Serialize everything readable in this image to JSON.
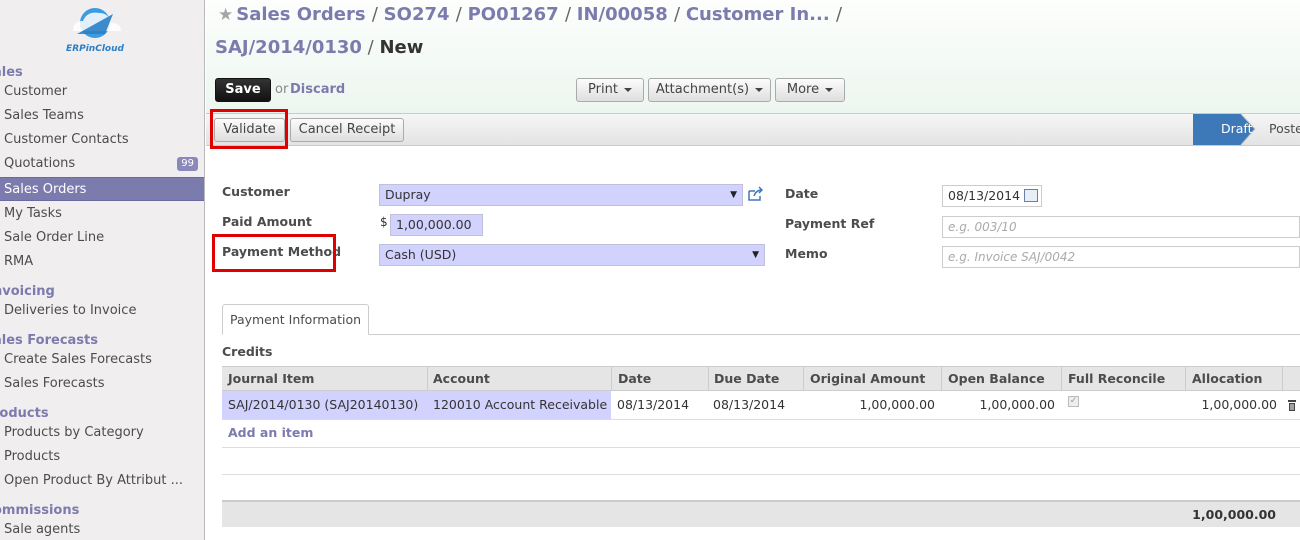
{
  "sidebar": {
    "sections": [
      {
        "label": "ales",
        "items": [
          {
            "label": "Customer"
          },
          {
            "label": "Sales Teams"
          },
          {
            "label": "Customer Contacts"
          },
          {
            "label": "Quotations",
            "badge": "99"
          },
          {
            "label": "Sales Orders",
            "active": true
          },
          {
            "label": "My Tasks"
          },
          {
            "label": "Sale Order Line"
          },
          {
            "label": "RMA"
          }
        ]
      },
      {
        "label": "nvoicing",
        "items": [
          {
            "label": "Deliveries to Invoice"
          }
        ]
      },
      {
        "label": "ales Forecasts",
        "items": [
          {
            "label": "Create Sales Forecasts"
          },
          {
            "label": "Sales Forecasts"
          }
        ]
      },
      {
        "label": "roducts",
        "items": [
          {
            "label": "Products by Category"
          },
          {
            "label": "Products"
          },
          {
            "label": "Open Product By Attribut ..."
          }
        ]
      },
      {
        "label": "ommissions",
        "items": [
          {
            "label": "Sale agents"
          }
        ]
      }
    ],
    "logo_text": "ERPinCloud"
  },
  "breadcrumb": {
    "items": [
      "Sales Orders",
      "SO274",
      "PO01267",
      "IN/00058",
      "Customer In..."
    ],
    "line2_link": "SAJ/2014/0130",
    "current": "New"
  },
  "toolbar": {
    "save": "Save",
    "or": "or",
    "discard": "Discard",
    "print": "Print",
    "attachments": "Attachment(s)",
    "more": "More"
  },
  "statusbar": {
    "validate": "Validate",
    "cancel_receipt": "Cancel Receipt",
    "states": [
      "Draft",
      "Poste"
    ]
  },
  "form": {
    "customer_label": "Customer",
    "customer_value": "Dupray",
    "paid_amount_label": "Paid Amount",
    "currency_symbol": "$",
    "paid_amount_value": "1,00,000.00",
    "payment_method_label": "Payment Method",
    "payment_method_value": "Cash (USD)",
    "date_label": "Date",
    "date_value": "08/13/2014",
    "payment_ref_label": "Payment Ref",
    "payment_ref_placeholder": "e.g. 003/10",
    "memo_label": "Memo",
    "memo_placeholder": "e.g. Invoice SAJ/0042"
  },
  "tab": {
    "label": "Payment Information"
  },
  "credits": {
    "title": "Credits",
    "columns": [
      "Journal Item",
      "Account",
      "Date",
      "Due Date",
      "Original Amount",
      "Open Balance",
      "Full Reconcile",
      "Allocation"
    ],
    "rows": [
      {
        "journal_item": "SAJ/2014/0130 (SAJ20140130)",
        "account": "120010 Account Receivable",
        "date": "08/13/2014",
        "due_date": "08/13/2014",
        "original_amount": "1,00,000.00",
        "open_balance": "1,00,000.00",
        "full_reconcile": true,
        "allocation": "1,00,000.00"
      }
    ],
    "add_item": "Add an item",
    "total": "1,00,000.00"
  },
  "colors": {
    "accent": "#7c7bad",
    "active_state": "#3d78b8",
    "highlight_box": "#e00000",
    "required_field": "#d2d2ff"
  }
}
